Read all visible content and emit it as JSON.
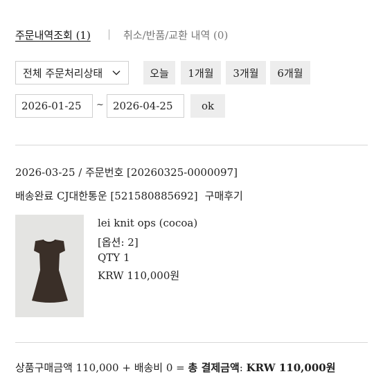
{
  "tabs": {
    "active_label": "주문내역조회 (1)",
    "separator": "|",
    "inactive_label": "취소/반품/교환 내역 (0)"
  },
  "filter": {
    "status_select": "전체 주문처리상태",
    "periods": [
      "오늘",
      "1개월",
      "3개월",
      "6개월"
    ],
    "date_from": "2026-01-25",
    "date_sep": "~",
    "date_to": "2026-04-25",
    "submit_label": "ok"
  },
  "order": {
    "date": "2026-03-25",
    "order_no_text": "/ 주문번호 [20260325-0000097]",
    "shipping_status": "배송완료 CJ대한통운 [521580885692]",
    "review_label": "구매후기",
    "product": {
      "name": "lei knit ops (cocoa)",
      "option": "[옵션: 2]",
      "qty": "QTY 1",
      "price": "KRW 110,000원"
    }
  },
  "summary": {
    "prefix": "상품구매금액 110,000 + 배송비 0 =",
    "total_label": "총 결제금액",
    "colon": ":",
    "total_value": "KRW 110,000원"
  },
  "colors": {
    "button_bg": "#ededed",
    "border": "#cfcfcf",
    "dress": "#3a2f28"
  },
  "icons": {
    "select_arrow": "chevron-down-icon"
  }
}
